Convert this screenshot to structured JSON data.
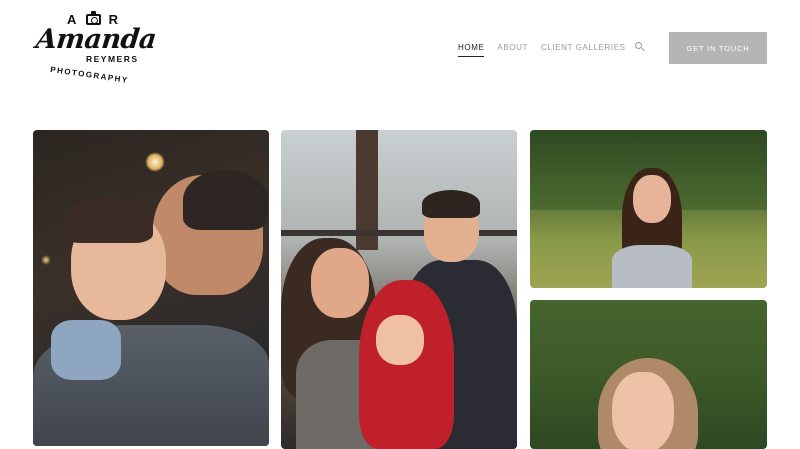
{
  "logo": {
    "initial_left": "A",
    "initial_right": "R",
    "script_name": "Amanda",
    "line1": "REYMERS",
    "line2": "PHOTOGRAPHY"
  },
  "nav": {
    "items": [
      {
        "label": "HOME",
        "active": true
      },
      {
        "label": "ABOUT",
        "active": false
      },
      {
        "label": "CLIENT GALLERIES",
        "active": false
      }
    ],
    "search_icon": "search-icon",
    "cta_label": "GET IN TOUCH"
  },
  "colors": {
    "cta_bg": "#b5b5b5",
    "nav_inactive": "#9b9b9b",
    "nav_active": "#1a1a1a"
  },
  "gallery": {
    "photos": [
      {
        "subject": "father kissing young boy"
      },
      {
        "subject": "mother with two children outdoors"
      },
      {
        "subject": "young woman in field"
      },
      {
        "subject": "young woman smiling in greenery"
      }
    ]
  }
}
